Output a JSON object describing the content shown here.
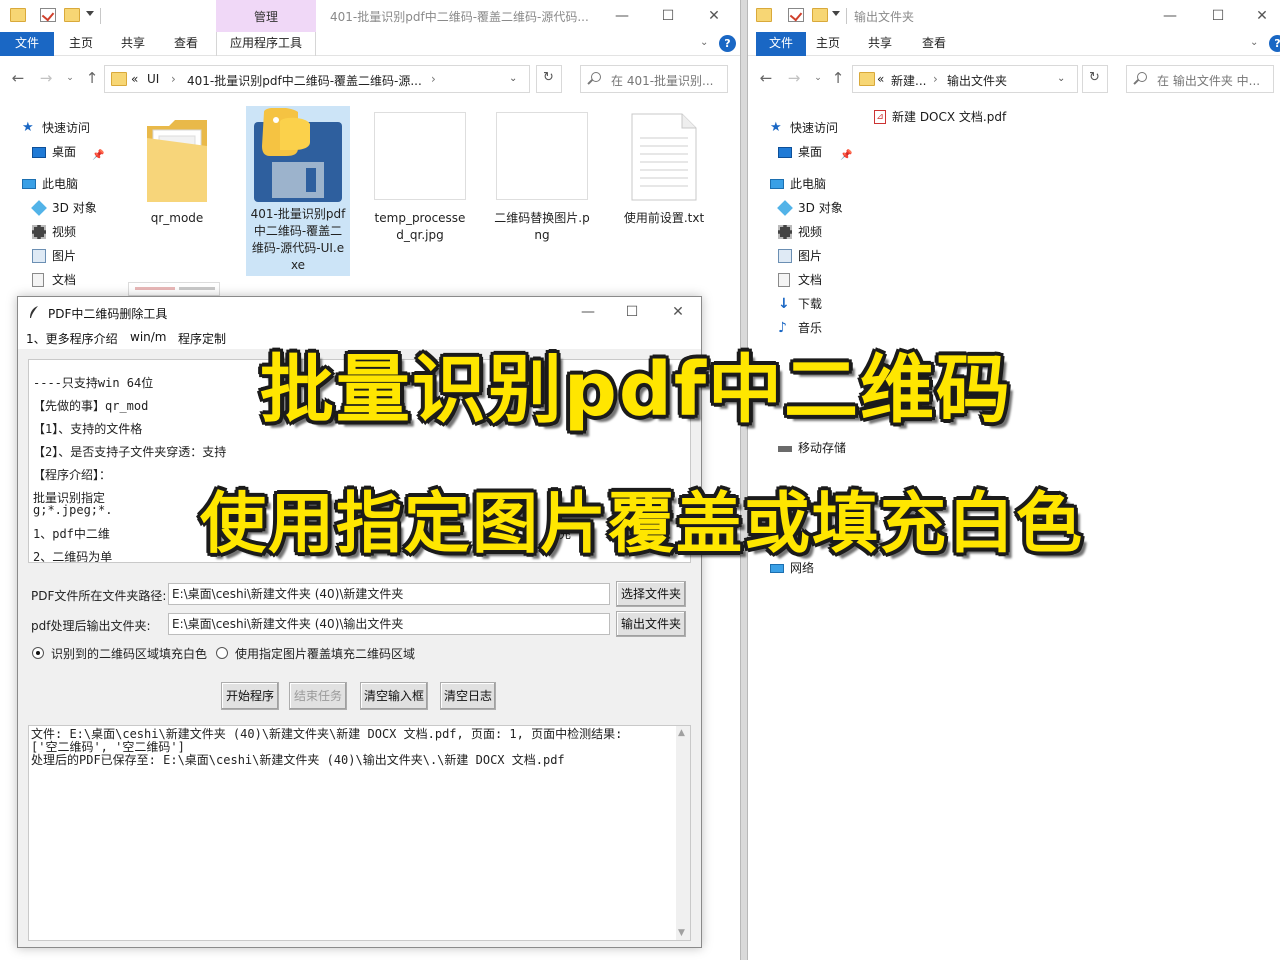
{
  "left_window": {
    "title": "401-批量识别pdf中二维码-覆盖二维码-源代码...",
    "manage_tab": "管理",
    "ribbon_tabs": [
      "文件",
      "主页",
      "共享",
      "查看",
      "应用程序工具"
    ],
    "breadcrumb": {
      "prefix": "«",
      "segment1": "UI",
      "segment2": "401-批量识别pdf中二维码-覆盖二维码-源..."
    },
    "search_placeholder": "在 401-批量识别...",
    "sidebar": [
      "快速访问",
      "桌面",
      "此电脑",
      "3D 对象",
      "视频",
      "图片",
      "文档"
    ],
    "files": [
      {
        "name": "qr_mode",
        "icon": "folder-icon"
      },
      {
        "name": "401-批量识别pdf中二维码-覆盖二维码-源代码-UI.exe",
        "icon": "python-exe-icon",
        "selected": true
      },
      {
        "name": "temp_processed_qr.jpg",
        "icon": "image-file-icon"
      },
      {
        "name": "二维码替换图片.png",
        "icon": "image-file-icon"
      },
      {
        "name": "使用前设置.txt",
        "icon": "text-file-icon"
      }
    ]
  },
  "right_window": {
    "title": "输出文件夹",
    "ribbon_tabs": [
      "文件",
      "主页",
      "共享",
      "查看"
    ],
    "breadcrumb": {
      "prefix": "«",
      "segment1": "新建...",
      "segment2": "输出文件夹"
    },
    "search_placeholder": "在 输出文件夹 中...",
    "sidebar": [
      "快速访问",
      "桌面",
      "此电脑",
      "3D 对象",
      "视频",
      "图片",
      "文档",
      "下载",
      "音乐",
      "移动存储",
      "网络"
    ],
    "files": [
      {
        "name": "新建 DOCX 文档.pdf",
        "icon": "pdf-file-icon"
      }
    ]
  },
  "tool": {
    "title": "PDF中二维码删除工具",
    "menu": [
      "1、更多程序介绍",
      "win/m",
      "程序定制"
    ],
    "info_lines": [
      "----只支持win 64位",
      "【先做的事】qr_mod",
      "【1】、支持的文件格",
      "【2】、是否支持子文件夹穿透：支持",
      "【程序介绍】：",
      "批量识别指定",
      "g;*.jpeg;*.",
      "1、pdf中二维",
      "2、二维码为单"
    ],
    "info_tail": "充",
    "pdf_folder_label": "PDF文件所在文件夹路径:",
    "pdf_folder_value": "E:\\桌面\\ceshi\\新建文件夹 (40)\\新建文件夹",
    "select_folder_button": "选择文件夹",
    "output_folder_label": "pdf处理后输出文件夹:",
    "output_folder_value": "E:\\桌面\\ceshi\\新建文件夹 (40)\\输出文件夹",
    "output_folder_button": "输出文件夹",
    "radio_fill_white": "识别到的二维码区域填充白色",
    "radio_use_image": "使用指定图片覆盖填充二维码区域",
    "buttons": {
      "start": "开始程序",
      "stop": "结束任务",
      "clear_input": "清空输入框",
      "clear_log": "清空日志"
    },
    "log_lines": [
      "文件: E:\\桌面\\ceshi\\新建文件夹 (40)\\新建文件夹\\新建 DOCX 文档.pdf, 页面: 1, 页面中检测结果:",
      "['空二维码', '空二维码']",
      "处理后的PDF已保存至: E:\\桌面\\ceshi\\新建文件夹 (40)\\输出文件夹\\.\\新建 DOCX 文档.pdf"
    ]
  },
  "overlay": {
    "line1": "批量识别pdf中二维码",
    "line2": "使用指定图片覆盖或填充白色"
  }
}
